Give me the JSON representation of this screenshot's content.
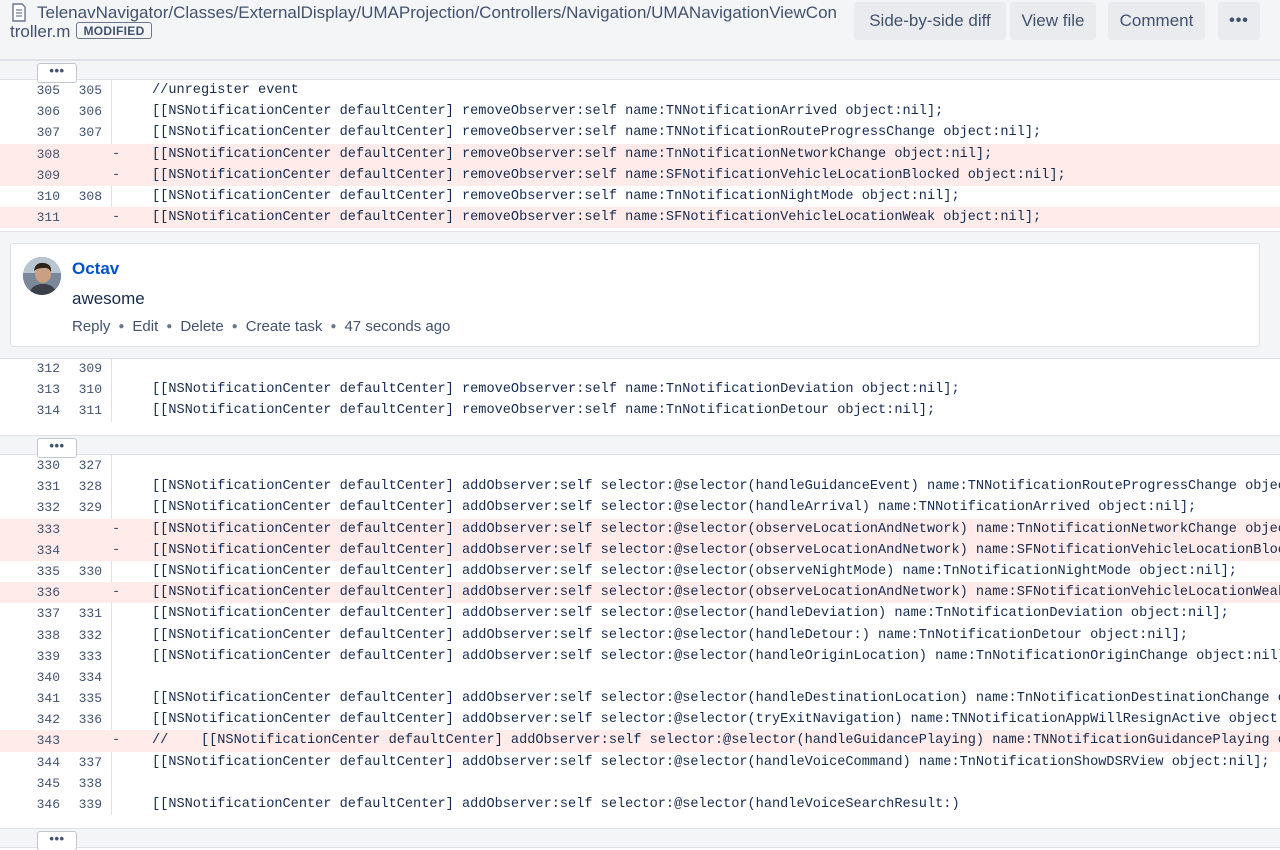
{
  "header": {
    "path": "TelenavNavigator/Classes/ExternalDisplay/UMAProjection/Controllers/Navigation/UMANavigationViewController.m",
    "badge": "MODIFIED",
    "side_by_side_label": "Side-by-side diff",
    "view_file_label": "View file",
    "comment_label": "Comment",
    "more_label": "•••"
  },
  "expand_label": "•••",
  "hunk1": [
    {
      "old": "305",
      "new": "305",
      "mark": "",
      "code": "//unregister event",
      "type": "ctx"
    },
    {
      "old": "306",
      "new": "306",
      "mark": "",
      "code": "[[NSNotificationCenter defaultCenter] removeObserver:self name:TNNotificationArrived object:nil];",
      "type": "ctx"
    },
    {
      "old": "307",
      "new": "307",
      "mark": "",
      "code": "[[NSNotificationCenter defaultCenter] removeObserver:self name:TNNotificationRouteProgressChange object:nil];",
      "type": "ctx"
    },
    {
      "old": "308",
      "new": "",
      "mark": "-",
      "code": "[[NSNotificationCenter defaultCenter] removeObserver:self name:TnNotificationNetworkChange object:nil];",
      "type": "del"
    },
    {
      "old": "309",
      "new": "",
      "mark": "-",
      "code": "[[NSNotificationCenter defaultCenter] removeObserver:self name:SFNotificationVehicleLocationBlocked object:nil];",
      "type": "del"
    },
    {
      "old": "310",
      "new": "308",
      "mark": "",
      "code": "[[NSNotificationCenter defaultCenter] removeObserver:self name:TnNotificationNightMode object:nil];",
      "type": "ctx"
    },
    {
      "old": "311",
      "new": "",
      "mark": "-",
      "code": "[[NSNotificationCenter defaultCenter] removeObserver:self name:SFNotificationVehicleLocationWeak object:nil];",
      "type": "del"
    }
  ],
  "comment": {
    "author": "Octav",
    "text": "awesome",
    "actions": [
      "Reply",
      "Edit",
      "Delete",
      "Create task"
    ],
    "time": "47 seconds ago"
  },
  "hunk2": [
    {
      "old": "312",
      "new": "309",
      "mark": "",
      "code": "",
      "type": "ctx"
    },
    {
      "old": "313",
      "new": "310",
      "mark": "",
      "code": "[[NSNotificationCenter defaultCenter] removeObserver:self name:TnNotificationDeviation object:nil];",
      "type": "ctx"
    },
    {
      "old": "314",
      "new": "311",
      "mark": "",
      "code": "[[NSNotificationCenter defaultCenter] removeObserver:self name:TnNotificationDetour object:nil];",
      "type": "ctx"
    }
  ],
  "hunk3": [
    {
      "old": "330",
      "new": "327",
      "mark": "",
      "code": "",
      "type": "ctx"
    },
    {
      "old": "331",
      "new": "328",
      "mark": "",
      "code": "[[NSNotificationCenter defaultCenter] addObserver:self selector:@selector(handleGuidanceEvent) name:TNNotificationRouteProgressChange object:nil];",
      "type": "ctx"
    },
    {
      "old": "332",
      "new": "329",
      "mark": "",
      "code": "[[NSNotificationCenter defaultCenter] addObserver:self selector:@selector(handleArrival) name:TNNotificationArrived object:nil];",
      "type": "ctx"
    },
    {
      "old": "333",
      "new": "",
      "mark": "-",
      "code": "[[NSNotificationCenter defaultCenter] addObserver:self selector:@selector(observeLocationAndNetwork) name:TnNotificationNetworkChange object:nil];",
      "type": "del"
    },
    {
      "old": "334",
      "new": "",
      "mark": "-",
      "code": "[[NSNotificationCenter defaultCenter] addObserver:self selector:@selector(observeLocationAndNetwork) name:SFNotificationVehicleLocationBlocked object:nil];",
      "type": "del"
    },
    {
      "old": "335",
      "new": "330",
      "mark": "",
      "code": "[[NSNotificationCenter defaultCenter] addObserver:self selector:@selector(observeNightMode) name:TnNotificationNightMode object:nil];",
      "type": "ctx"
    },
    {
      "old": "336",
      "new": "",
      "mark": "-",
      "code": "[[NSNotificationCenter defaultCenter] addObserver:self selector:@selector(observeLocationAndNetwork) name:SFNotificationVehicleLocationWeak object:nil];",
      "type": "del"
    },
    {
      "old": "337",
      "new": "331",
      "mark": "",
      "code": "[[NSNotificationCenter defaultCenter] addObserver:self selector:@selector(handleDeviation) name:TnNotificationDeviation object:nil];",
      "type": "ctx"
    },
    {
      "old": "338",
      "new": "332",
      "mark": "",
      "code": "[[NSNotificationCenter defaultCenter] addObserver:self selector:@selector(handleDetour:) name:TnNotificationDetour object:nil];",
      "type": "ctx"
    },
    {
      "old": "339",
      "new": "333",
      "mark": "",
      "code": "[[NSNotificationCenter defaultCenter] addObserver:self selector:@selector(handleOriginLocation) name:TnNotificationOriginChange object:nil];",
      "type": "ctx"
    },
    {
      "old": "340",
      "new": "334",
      "mark": "",
      "code": "",
      "type": "ctx"
    },
    {
      "old": "341",
      "new": "335",
      "mark": "",
      "code": "[[NSNotificationCenter defaultCenter] addObserver:self selector:@selector(handleDestinationLocation) name:TnNotificationDestinationChange object:nil];",
      "type": "ctx"
    },
    {
      "old": "342",
      "new": "336",
      "mark": "",
      "code": "[[NSNotificationCenter defaultCenter] addObserver:self selector:@selector(tryExitNavigation) name:TNNotificationAppWillResignActive object:nil];",
      "type": "ctx"
    },
    {
      "old": "343",
      "new": "",
      "mark": "-",
      "code": "//    [[NSNotificationCenter defaultCenter] addObserver:self selector:@selector(handleGuidancePlaying) name:TNNotificationGuidancePlaying object:nil];",
      "type": "del"
    },
    {
      "old": "344",
      "new": "337",
      "mark": "",
      "code": "[[NSNotificationCenter defaultCenter] addObserver:self selector:@selector(handleVoiceCommand) name:TnNotificationShowDSRView object:nil];",
      "type": "ctx"
    },
    {
      "old": "345",
      "new": "338",
      "mark": "",
      "code": "",
      "type": "ctx"
    },
    {
      "old": "346",
      "new": "339",
      "mark": "",
      "code": "[[NSNotificationCenter defaultCenter] addObserver:self selector:@selector(handleVoiceSearchResult:)",
      "type": "ctx"
    }
  ]
}
